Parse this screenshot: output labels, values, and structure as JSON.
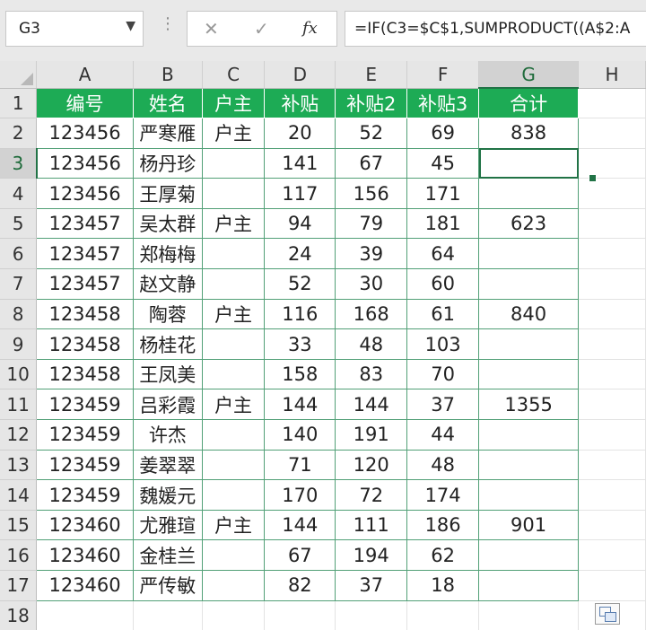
{
  "name_box": {
    "value": "G3"
  },
  "formula_bar": {
    "fx_label": "fx",
    "formula": "=IF(C3=$C$1,SUMPRODUCT((A$2:A"
  },
  "columns": [
    "A",
    "B",
    "C",
    "D",
    "E",
    "F",
    "G",
    "H"
  ],
  "headers": [
    "编号",
    "姓名",
    "户主",
    "补贴",
    "补贴2",
    "补贴3",
    "合计"
  ],
  "rows": [
    [
      "123456",
      "严寒雁",
      "户主",
      "20",
      "52",
      "69",
      "838"
    ],
    [
      "123456",
      "杨丹珍",
      "",
      "141",
      "67",
      "45",
      ""
    ],
    [
      "123456",
      "王厚菊",
      "",
      "117",
      "156",
      "171",
      ""
    ],
    [
      "123457",
      "吴太群",
      "户主",
      "94",
      "79",
      "181",
      "623"
    ],
    [
      "123457",
      "郑梅梅",
      "",
      "24",
      "39",
      "64",
      ""
    ],
    [
      "123457",
      "赵文静",
      "",
      "52",
      "30",
      "60",
      ""
    ],
    [
      "123458",
      "陶蓉",
      "户主",
      "116",
      "168",
      "61",
      "840"
    ],
    [
      "123458",
      "杨桂花",
      "",
      "33",
      "48",
      "103",
      ""
    ],
    [
      "123458",
      "王凤美",
      "",
      "158",
      "83",
      "70",
      ""
    ],
    [
      "123459",
      "吕彩霞",
      "户主",
      "144",
      "144",
      "37",
      "1355"
    ],
    [
      "123459",
      "许杰",
      "",
      "140",
      "191",
      "44",
      ""
    ],
    [
      "123459",
      "姜翠翠",
      "",
      "71",
      "120",
      "48",
      ""
    ],
    [
      "123459",
      "魏媛元",
      "",
      "170",
      "72",
      "174",
      ""
    ],
    [
      "123460",
      "尤雅瑄",
      "户主",
      "144",
      "111",
      "186",
      "901"
    ],
    [
      "123460",
      "金桂兰",
      "",
      "67",
      "194",
      "62",
      ""
    ],
    [
      "123460",
      "严传敏",
      "",
      "82",
      "37",
      "18",
      ""
    ]
  ],
  "row_numbers": [
    "1",
    "2",
    "3",
    "4",
    "5",
    "6",
    "7",
    "8",
    "9",
    "10",
    "11",
    "12",
    "13",
    "14",
    "15",
    "16",
    "17",
    "18"
  ],
  "active_cell": "G3",
  "colors": {
    "header_fill": "#1dab55",
    "grid_green": "#52a077",
    "selection": "#217346"
  }
}
